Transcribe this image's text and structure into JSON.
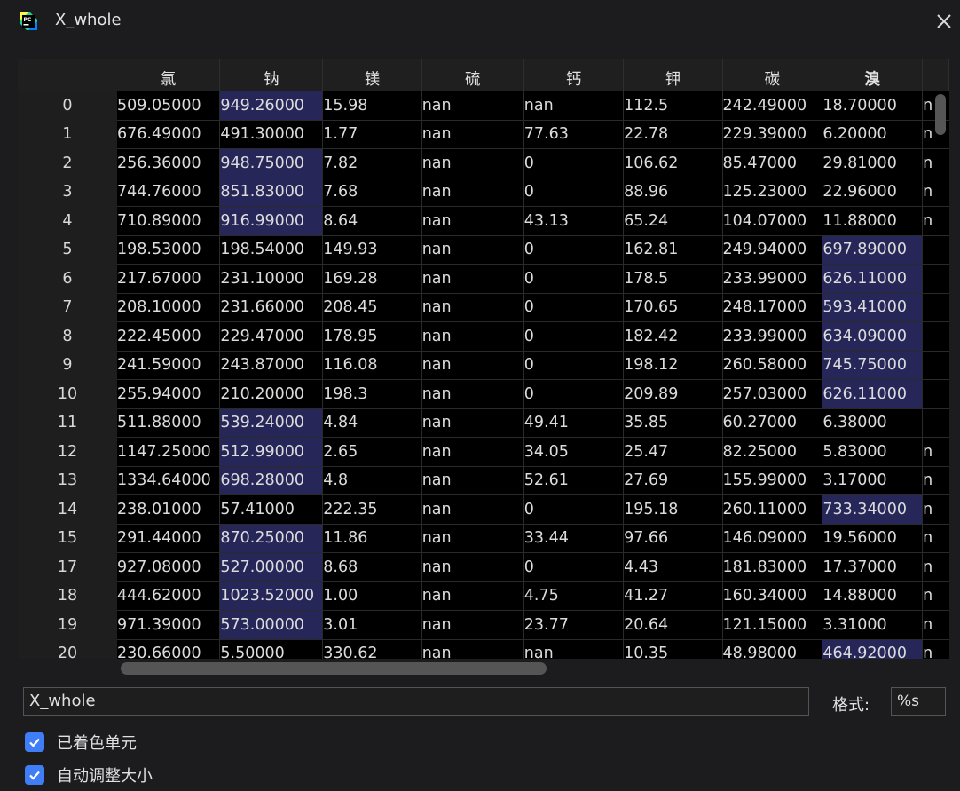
{
  "window": {
    "title": "X_whole"
  },
  "table": {
    "columns": [
      {
        "label": "氯",
        "bold": false
      },
      {
        "label": "钠",
        "bold": false
      },
      {
        "label": "镁",
        "bold": false
      },
      {
        "label": "硫",
        "bold": false
      },
      {
        "label": "钙",
        "bold": false
      },
      {
        "label": "钾",
        "bold": false
      },
      {
        "label": "碳",
        "bold": false
      },
      {
        "label": "溴",
        "bold": true
      }
    ],
    "rows": [
      {
        "index": "0",
        "cells": [
          "509.05000",
          "949.26000",
          "15.98",
          "nan",
          "nan",
          "112.5",
          "242.49000",
          "18.70000"
        ],
        "edge": "n",
        "highlight": [
          1
        ]
      },
      {
        "index": "1",
        "cells": [
          "676.49000",
          "491.30000",
          "1.77",
          "nan",
          "77.63",
          "22.78",
          "229.39000",
          "6.20000"
        ],
        "edge": "n",
        "highlight": []
      },
      {
        "index": "2",
        "cells": [
          "256.36000",
          "948.75000",
          "7.82",
          "nan",
          "0",
          "106.62",
          "85.47000",
          "29.81000"
        ],
        "edge": "n",
        "highlight": [
          1
        ]
      },
      {
        "index": "3",
        "cells": [
          "744.76000",
          "851.83000",
          "7.68",
          "nan",
          "0",
          "88.96",
          "125.23000",
          "22.96000"
        ],
        "edge": "n",
        "highlight": [
          1
        ]
      },
      {
        "index": "4",
        "cells": [
          "710.89000",
          "916.99000",
          "8.64",
          "nan",
          "43.13",
          "65.24",
          "104.07000",
          "11.88000"
        ],
        "edge": "n",
        "highlight": [
          1
        ]
      },
      {
        "index": "5",
        "cells": [
          "198.53000",
          "198.54000",
          "149.93",
          "nan",
          "0",
          "162.81",
          "249.94000",
          "697.89000"
        ],
        "edge": "",
        "highlight": [
          7
        ]
      },
      {
        "index": "6",
        "cells": [
          "217.67000",
          "231.10000",
          "169.28",
          "nan",
          "0",
          "178.5",
          "233.99000",
          "626.11000"
        ],
        "edge": "",
        "highlight": [
          7
        ]
      },
      {
        "index": "7",
        "cells": [
          "208.10000",
          "231.66000",
          "208.45",
          "nan",
          "0",
          "170.65",
          "248.17000",
          "593.41000"
        ],
        "edge": "",
        "highlight": [
          7
        ]
      },
      {
        "index": "8",
        "cells": [
          "222.45000",
          "229.47000",
          "178.95",
          "nan",
          "0",
          "182.42",
          "233.99000",
          "634.09000"
        ],
        "edge": "",
        "highlight": [
          7
        ]
      },
      {
        "index": "9",
        "cells": [
          "241.59000",
          "243.87000",
          "116.08",
          "nan",
          "0",
          "198.12",
          "260.58000",
          "745.75000"
        ],
        "edge": "",
        "highlight": [
          7
        ]
      },
      {
        "index": "10",
        "cells": [
          "255.94000",
          "210.20000",
          "198.3",
          "nan",
          "0",
          "209.89",
          "257.03000",
          "626.11000"
        ],
        "edge": "",
        "highlight": [
          7
        ]
      },
      {
        "index": "11",
        "cells": [
          "511.88000",
          "539.24000",
          "4.84",
          "nan",
          "49.41",
          "35.85",
          "60.27000",
          "6.38000"
        ],
        "edge": "",
        "highlight": [
          1
        ]
      },
      {
        "index": "12",
        "cells": [
          "1147.25000",
          "512.99000",
          "2.65",
          "nan",
          "34.05",
          "25.47",
          "82.25000",
          "5.83000"
        ],
        "edge": "n",
        "highlight": [
          1
        ]
      },
      {
        "index": "13",
        "cells": [
          "1334.64000",
          "698.28000",
          "4.8",
          "nan",
          "52.61",
          "27.69",
          "155.99000",
          "3.17000"
        ],
        "edge": "n",
        "highlight": [
          1
        ]
      },
      {
        "index": "14",
        "cells": [
          "238.01000",
          "57.41000",
          "222.35",
          "nan",
          "0",
          "195.18",
          "260.11000",
          "733.34000"
        ],
        "edge": "n",
        "highlight": [
          7
        ]
      },
      {
        "index": "15",
        "cells": [
          "291.44000",
          "870.25000",
          "11.86",
          "nan",
          "33.44",
          "97.66",
          "146.09000",
          "19.56000"
        ],
        "edge": "n",
        "highlight": [
          1
        ]
      },
      {
        "index": "17",
        "cells": [
          "927.08000",
          "527.00000",
          "8.68",
          "nan",
          "0",
          "4.43",
          "181.83000",
          "17.37000"
        ],
        "edge": "n",
        "highlight": [
          1
        ]
      },
      {
        "index": "18",
        "cells": [
          "444.62000",
          "1023.52000",
          "1.00",
          "nan",
          "4.75",
          "41.27",
          "160.34000",
          "14.88000"
        ],
        "edge": "n",
        "highlight": [
          1
        ]
      },
      {
        "index": "19",
        "cells": [
          "971.39000",
          "573.00000",
          "3.01",
          "nan",
          "23.77",
          "20.64",
          "121.15000",
          "3.31000"
        ],
        "edge": "n",
        "highlight": [
          1
        ]
      },
      {
        "index": "20",
        "cells": [
          "230.66000",
          "5.50000",
          "330.62",
          "nan",
          "nan",
          "10.35",
          "48.98000",
          "464.92000"
        ],
        "edge": "n",
        "highlight": [
          7
        ]
      }
    ]
  },
  "name_field": {
    "value": "X_whole"
  },
  "format": {
    "label": "格式:",
    "value": "%s"
  },
  "options": [
    {
      "label": "已着色单元",
      "checked": true
    },
    {
      "label": "自动调整大小",
      "checked": true
    }
  ],
  "colors": {
    "background": "#1c1c1f",
    "cell": "#000000",
    "highlight": "#262658",
    "accent": "#3f7ef7"
  }
}
